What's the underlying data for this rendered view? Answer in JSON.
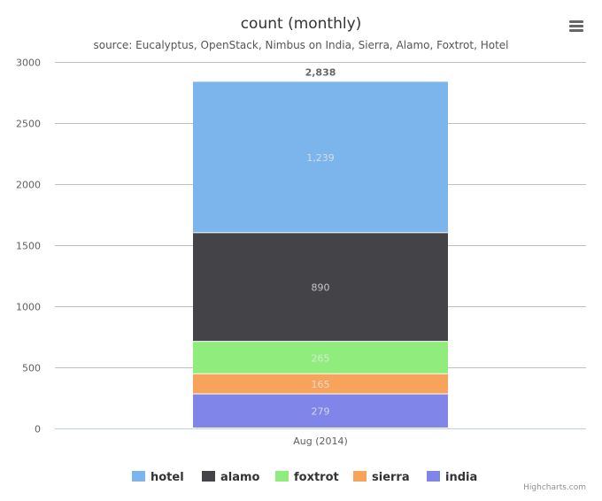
{
  "chart_data": {
    "type": "bar",
    "stacked": true,
    "title": "count (monthly)",
    "subtitle": "source: Eucalyptus, OpenStack, Nimbus on India, Sierra, Alamo, Foxtrot, Hotel",
    "categories": [
      "Aug (2014)"
    ],
    "xlabel": "",
    "ylabel": "",
    "ylim": [
      0,
      3000
    ],
    "yticks": [
      0,
      500,
      1000,
      1500,
      2000,
      2500,
      3000
    ],
    "grid": true,
    "series": [
      {
        "name": "india",
        "values": [
          279
        ],
        "color": "#8085e9",
        "label": "279"
      },
      {
        "name": "sierra",
        "values": [
          165
        ],
        "color": "#f7a35c",
        "label": "165"
      },
      {
        "name": "foxtrot",
        "values": [
          265
        ],
        "color": "#90ed7d",
        "label": "265"
      },
      {
        "name": "alamo",
        "values": [
          890
        ],
        "color": "#434348",
        "label": "890"
      },
      {
        "name": "hotel",
        "values": [
          1239
        ],
        "color": "#7cb5ec",
        "label": "1,239"
      }
    ],
    "totals": [
      2838
    ],
    "total_labels": [
      "2,838"
    ],
    "legend_order": [
      "hotel",
      "alamo",
      "foxtrot",
      "sierra",
      "india"
    ],
    "legend_position": "bottom-center"
  },
  "menu": {
    "icon": "hamburger-menu-icon"
  },
  "credits": "Highcharts.com"
}
